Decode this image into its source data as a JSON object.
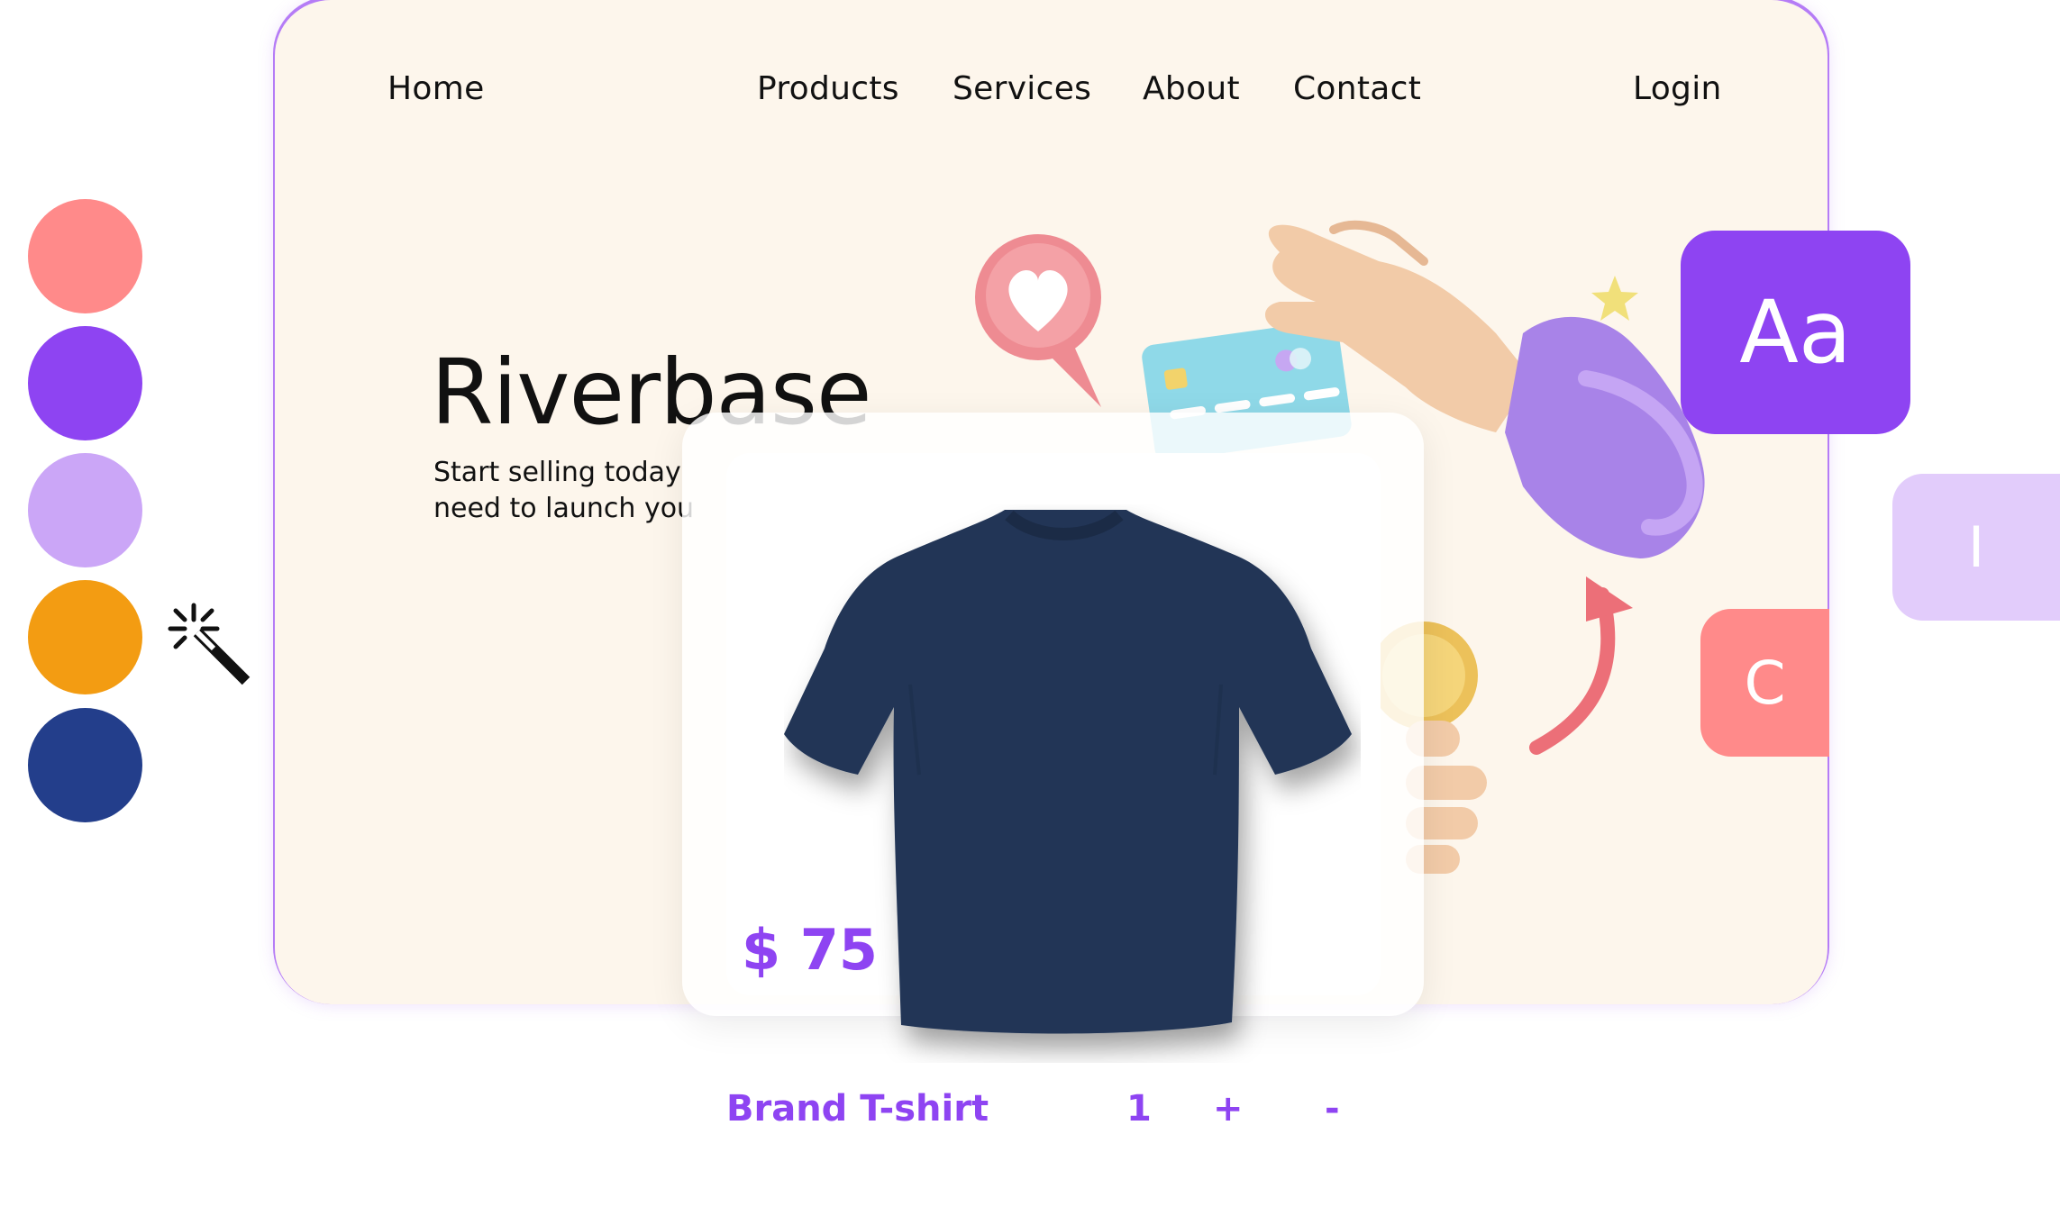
{
  "nav": {
    "home": "Home",
    "products": "Products",
    "services": "Services",
    "about": "About",
    "contact": "Contact",
    "login": "Login"
  },
  "hero": {
    "title": "Riverbase",
    "subtitle_line1": "Start selling today",
    "subtitle_line2": "need to launch you"
  },
  "palette": {
    "colors": [
      "#ff8a8a",
      "#8e44f2",
      "#cba6f7",
      "#f39c12",
      "#233e8b"
    ],
    "tool_icon": "magic-wand-icon"
  },
  "font_tiles": {
    "aa_label": "Aa",
    "i_label": "I",
    "c_label": "C",
    "aa_color": "#8e44f2",
    "i_color": "#e2ccfb",
    "c_color": "#ff8a8a"
  },
  "product": {
    "price": "$ 75",
    "name": "Brand T-shirt",
    "quantity": "1",
    "increase_label": "+",
    "decrease_label": "-",
    "accent": "#8e44f2",
    "shirt_color": "#233656"
  }
}
